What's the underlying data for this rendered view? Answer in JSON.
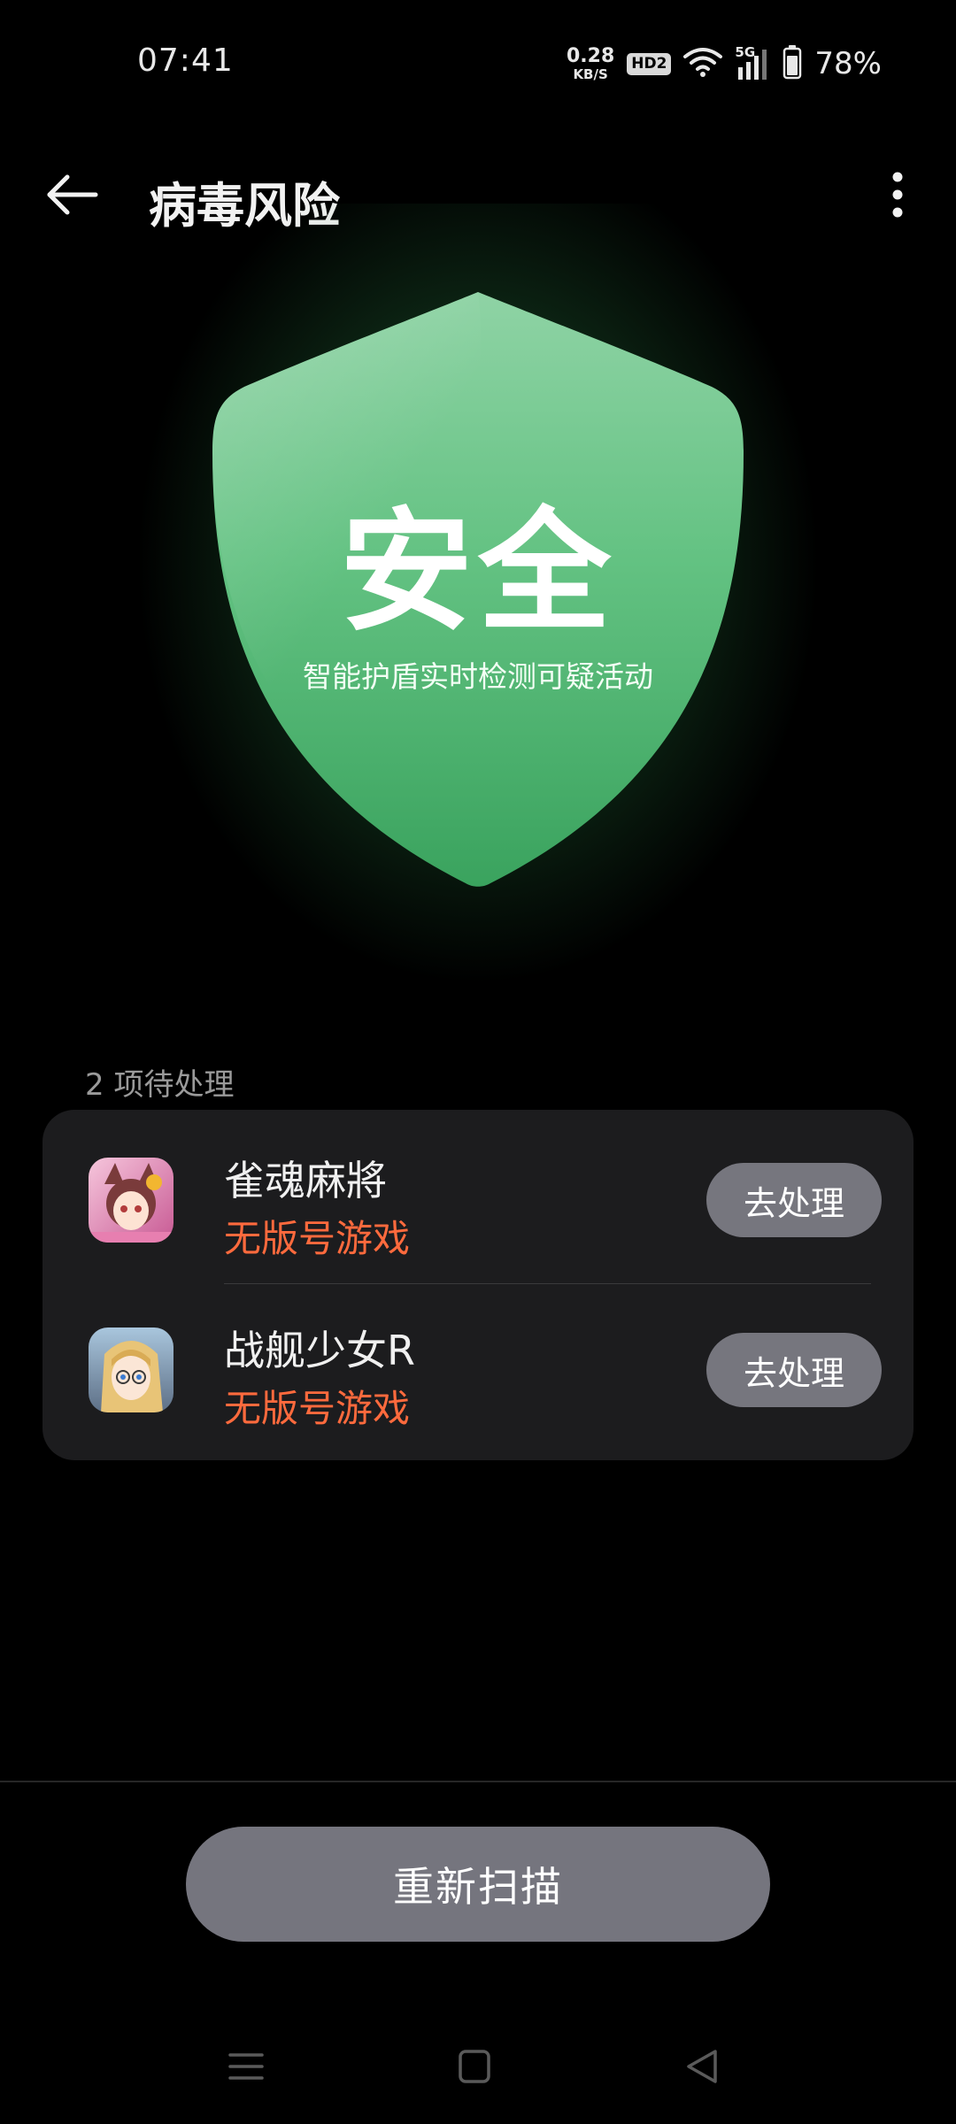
{
  "status_bar": {
    "time": "07:41",
    "net_speed_value": "0.28",
    "net_speed_unit": "KB/S",
    "hd_badge": "HD2",
    "network_type": "5G",
    "battery_percent": "78%",
    "icons": [
      "wifi-icon",
      "signal-icon",
      "battery-icon"
    ]
  },
  "app_bar": {
    "title": "病毒风险",
    "back_icon": "arrow-left-icon",
    "more_icon": "more-vertical-icon"
  },
  "shield": {
    "status": "安全",
    "subtitle": "智能护盾实时检测可疑活动",
    "color": "#5bbf7c"
  },
  "pending": {
    "label": "2 项待处理",
    "items": [
      {
        "name": "雀魂麻將",
        "tag": "无版号游戏",
        "action": "去处理",
        "icon": "mahjong-soul-app-icon"
      },
      {
        "name": "战舰少女R",
        "tag": "无版号游戏",
        "action": "去处理",
        "icon": "warship-girls-app-icon"
      }
    ]
  },
  "bottom": {
    "rescan_label": "重新扫描"
  },
  "nav": {
    "icons": [
      "menu-icon",
      "home-icon",
      "back-triangle-icon"
    ]
  },
  "colors": {
    "background": "#000000",
    "card": "#1c1c1e",
    "button": "#76767e",
    "warning_text": "#ff6a3d",
    "shield_green": "#5bbf7c"
  }
}
